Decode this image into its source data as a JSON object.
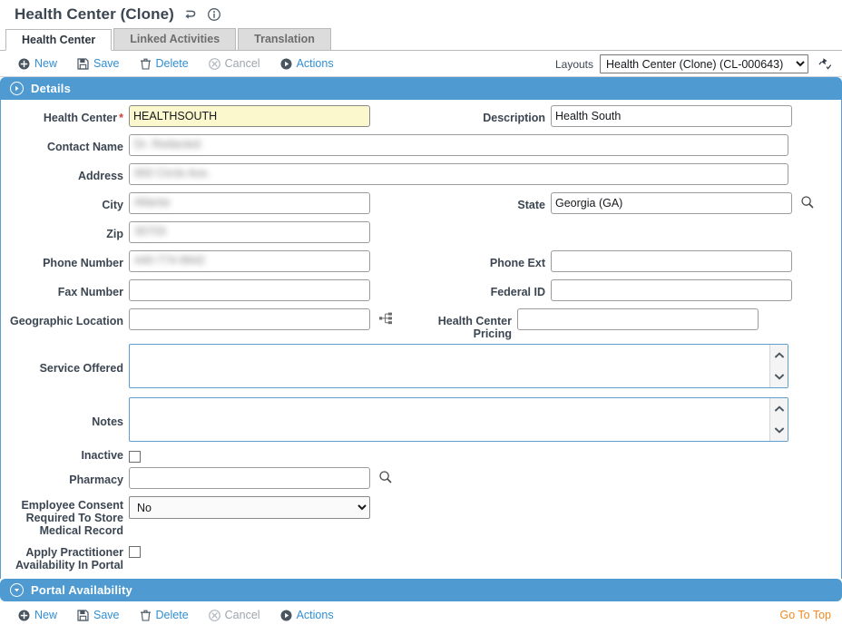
{
  "header": {
    "title": "Health Center (Clone)",
    "icons": [
      {
        "name": "undo-icon"
      },
      {
        "name": "info-icon"
      }
    ]
  },
  "tabs": [
    {
      "label": "Health Center",
      "active": true
    },
    {
      "label": "Linked Activities",
      "active": false
    },
    {
      "label": "Translation",
      "active": false
    }
  ],
  "toolbar": {
    "new_label": "New",
    "save_label": "Save",
    "delete_label": "Delete",
    "cancel_label": "Cancel",
    "actions_label": "Actions",
    "layouts_label": "Layouts",
    "layouts_value": "Health Center (Clone) (CL-000643)"
  },
  "sections": {
    "details": {
      "title": "Details",
      "expanded": true
    },
    "portal": {
      "title": "Portal Availability",
      "expanded": false
    }
  },
  "fields": {
    "health_center": {
      "label": "Health Center",
      "value": "HEALTHSOUTH",
      "required": true
    },
    "description": {
      "label": "Description",
      "value": "Health South"
    },
    "contact_name": {
      "label": "Contact Name",
      "value": "Dr. Redacted",
      "redacted": true
    },
    "address": {
      "label": "Address",
      "value": "900 Circle Ave.",
      "redacted": true
    },
    "city": {
      "label": "City",
      "value": "Atlanta",
      "redacted": true
    },
    "state": {
      "label": "State",
      "value": "Georgia (GA)"
    },
    "zip": {
      "label": "Zip",
      "value": "30703",
      "redacted": true
    },
    "phone_number": {
      "label": "Phone Number",
      "value": "440-774-9942",
      "redacted": true
    },
    "phone_ext": {
      "label": "Phone Ext",
      "value": ""
    },
    "fax_number": {
      "label": "Fax Number",
      "value": ""
    },
    "federal_id": {
      "label": "Federal ID",
      "value": ""
    },
    "geographic_location": {
      "label": "Geographic Location",
      "value": ""
    },
    "health_center_pricing": {
      "label": "Health Center Pricing",
      "value": ""
    },
    "service_offered": {
      "label": "Service Offered",
      "value": ""
    },
    "notes": {
      "label": "Notes",
      "value": ""
    },
    "inactive": {
      "label": "Inactive",
      "checked": false
    },
    "pharmacy": {
      "label": "Pharmacy",
      "value": ""
    },
    "employee_consent": {
      "label": "Employee Consent Required To Store Medical Record",
      "value": "No"
    },
    "apply_practitioner": {
      "label": "Apply Practitioner Availability In Portal",
      "checked": false
    }
  },
  "footer": {
    "new_label": "New",
    "save_label": "Save",
    "delete_label": "Delete",
    "cancel_label": "Cancel",
    "actions_label": "Actions",
    "goto_top_label": "Go To Top"
  },
  "colors": {
    "accent_blue": "#4e9ad1",
    "link_blue": "#2f8fd4",
    "required_yellow": "#fbf8cd",
    "required_star": "#d13f36",
    "goto_orange": "#ef8a22"
  }
}
